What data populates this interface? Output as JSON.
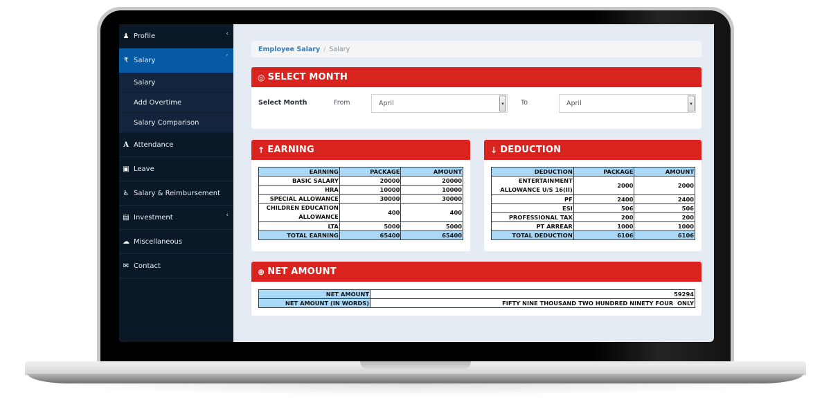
{
  "sidebar": {
    "items": [
      {
        "label": "Profile",
        "icon": "users-icon",
        "glyph": "♟",
        "caret": "‹",
        "active": false
      },
      {
        "label": "Salary",
        "icon": "rupee-icon",
        "glyph": "₹",
        "caret": "ˇ",
        "active": true
      },
      {
        "label": "Attendance",
        "icon": "attendance-a-icon",
        "glyph": "A",
        "caret": "",
        "active": false
      },
      {
        "label": "Leave",
        "icon": "calendar-icon",
        "glyph": "▣",
        "caret": "",
        "active": false
      },
      {
        "label": "Salary & Reimbursement",
        "icon": "wheelchair-icon",
        "glyph": "♿",
        "caret": "",
        "active": false
      },
      {
        "label": "Investment",
        "icon": "chart-icon",
        "glyph": "▤",
        "caret": "‹",
        "active": false
      },
      {
        "label": "Miscellaneous",
        "icon": "cloud-icon",
        "glyph": "☁",
        "caret": "",
        "active": false
      },
      {
        "label": "Contact",
        "icon": "envelope-icon",
        "glyph": "✉",
        "caret": "",
        "active": false
      }
    ],
    "salary_subitems": [
      "Salary",
      "Add Overtime",
      "Salary Comparison"
    ]
  },
  "breadcrumb": {
    "parent": "Employee Salary",
    "separator": "/",
    "current": "Salary"
  },
  "select_month": {
    "title": "SELECT MONTH",
    "icon_glyph": "◎",
    "label": "Select Month",
    "from_label": "From",
    "from_value": "April",
    "to_label": "To",
    "to_value": "April",
    "dropdown_glyph": "▾"
  },
  "earning": {
    "title": "EARNING",
    "icon_glyph": "↑",
    "headers": [
      "EARNING",
      "PACKAGE",
      "AMOUNT"
    ],
    "rows": [
      [
        "BASIC SALARY",
        "20000",
        "20000"
      ],
      [
        "HRA",
        "10000",
        "10000"
      ],
      [
        "SPECIAL ALLOWANCE",
        "30000",
        "30000"
      ],
      [
        "CHILDREN EDUCATION ALLOWANCE",
        "400",
        "400"
      ],
      [
        "LTA",
        "5000",
        "5000"
      ]
    ],
    "total": [
      "TOTAL EARNING",
      "65400",
      "65400"
    ]
  },
  "deduction": {
    "title": "DEDUCTION",
    "icon_glyph": "↓",
    "headers": [
      "DEDUCTION",
      "PACKAGE",
      "AMOUNT"
    ],
    "rows": [
      [
        "ENTERTAINMENT ALLOWANCE U/S 16(II)",
        "2000",
        "2000"
      ],
      [
        "PF",
        "2400",
        "2400"
      ],
      [
        "ESI",
        "506",
        "506"
      ],
      [
        "PROFESSIONAL TAX",
        "200",
        "200"
      ],
      [
        "PT ARREAR",
        "1000",
        "1000"
      ]
    ],
    "total": [
      "TOTAL DEDUCTION",
      "6106",
      "6106"
    ]
  },
  "net_amount": {
    "title": "NET AMOUNT",
    "icon_glyph": "⊕",
    "rows": [
      [
        "NET AMOUNT",
        "59294"
      ],
      [
        "NET AMOUNT (IN WORDS)",
        "FIFTY NINE THOUSAND TWO HUNDRED NINETY FOUR  ONLY"
      ]
    ]
  },
  "colors": {
    "accent_red": "#d9231e",
    "sidebar_bg": "#0b1828",
    "sidebar_active": "#065aa3",
    "table_header_blue": "#a9d9f7",
    "link_blue": "#2f7dc0"
  }
}
